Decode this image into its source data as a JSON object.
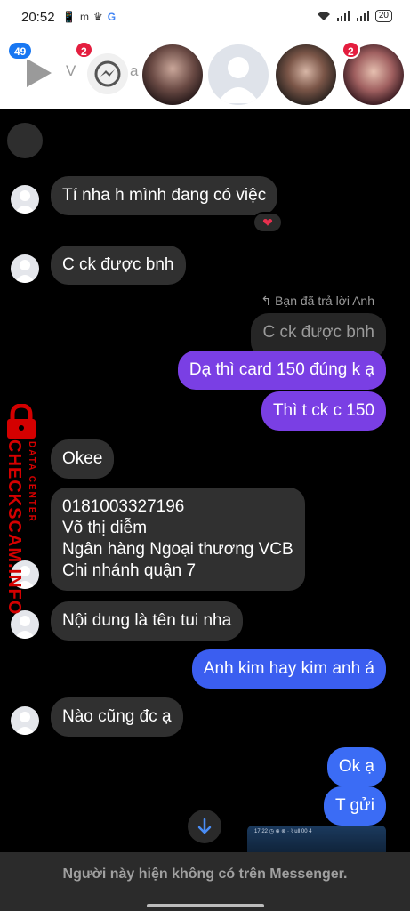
{
  "status_bar": {
    "time": "20:52",
    "app_icons": [
      "📱",
      "m",
      "♛",
      "G"
    ],
    "battery": "20",
    "right_icons": [
      "wifi-icon",
      "signal-icon",
      "signal-icon"
    ]
  },
  "header": {
    "unread_count": "49",
    "messenger_badge": "2",
    "story_badge": "2",
    "partial_label": "V",
    "partial_label2": "a"
  },
  "chat": {
    "messages": [
      {
        "side": "in",
        "text": "Tí nha h mình đang có việc",
        "reaction": "❤"
      },
      {
        "side": "in",
        "text": "C ck được bnh"
      },
      {
        "side": "note",
        "text": "Bạn đã trả lời Anh"
      },
      {
        "side": "quote",
        "text": "C ck được bnh"
      },
      {
        "side": "out",
        "text": "Dạ thì card 150 đúng k ạ"
      },
      {
        "side": "out",
        "text": "Thì t ck c 150"
      },
      {
        "side": "in",
        "text": "Okee"
      },
      {
        "side": "in",
        "text": "0181003327196\nVõ thị diễm\nNgân hàng Ngoại thương VCB\nChi nhánh quận 7"
      },
      {
        "side": "in",
        "text": "Nội dung là tên tui nha"
      },
      {
        "side": "out",
        "text": "Anh kim hay kim anh á"
      },
      {
        "side": "in",
        "text": "Nào cũng đc ạ"
      },
      {
        "side": "out",
        "text": "Ok ạ"
      },
      {
        "side": "out",
        "text": "T gửi"
      }
    ],
    "thumb_text": "17:22 ◷ ⊕ ⊗ ·  ⌇ ull 00 4"
  },
  "watermark": {
    "brand": "CHECKSCAM.INFO",
    "tagline": "DATA CENTER"
  },
  "footer": {
    "message": "Người này hiện không có trên Messenger."
  },
  "colors": {
    "outgoing_purple": "#7a3fe4",
    "outgoing_blue": "#3b5ef0",
    "incoming": "#303030",
    "badge_red": "#e41e3f",
    "badge_blue": "#1877f2",
    "watermark_red": "#d40000"
  }
}
